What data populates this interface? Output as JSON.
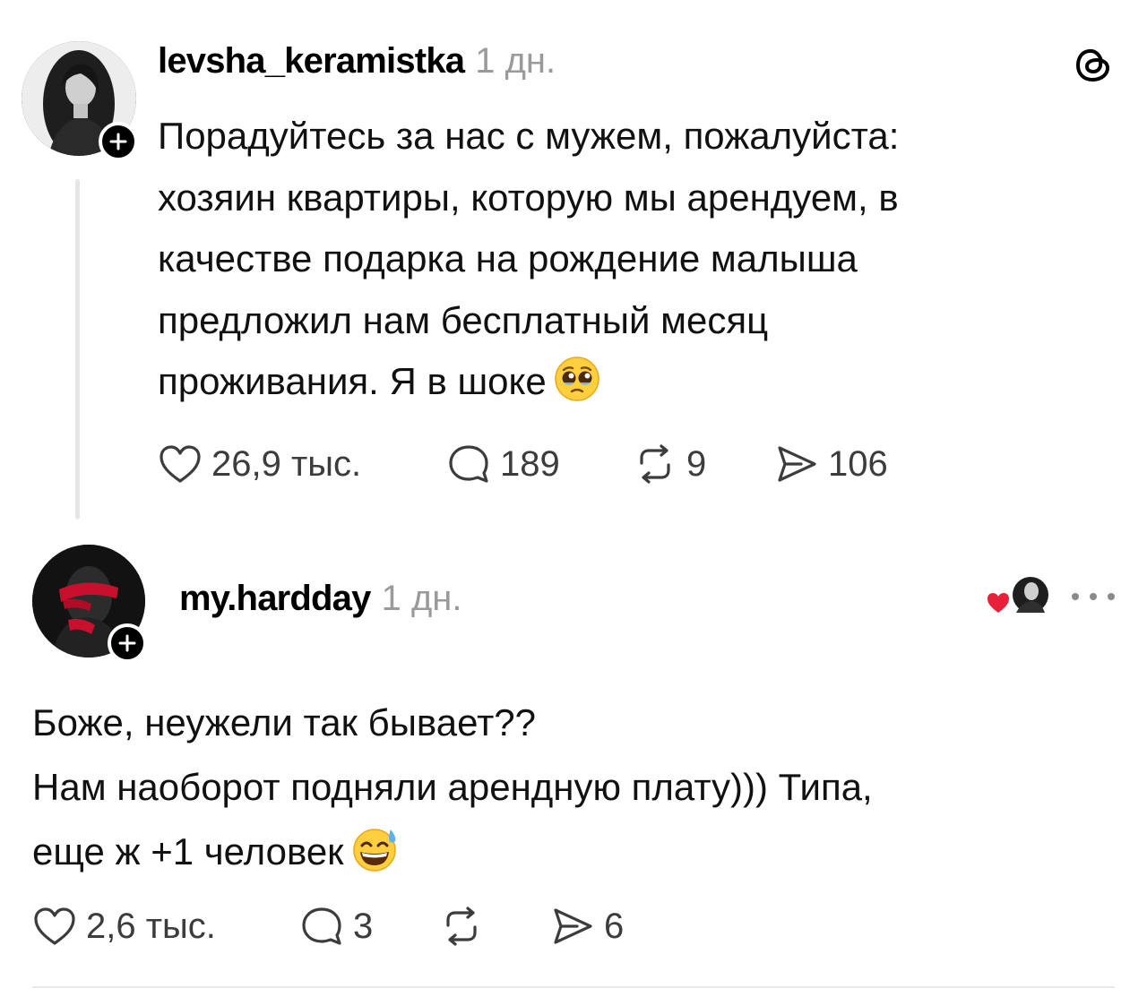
{
  "post": {
    "username": "levsha_keramistka",
    "time": "1 дн.",
    "text_lines": [
      "Порадуйтесь за нас с мужем, пожалуйста:",
      "хозяин квартиры, которую мы арендуем, в",
      "качестве подарка на рождение малыша",
      "предложил нам бесплатный месяц",
      "проживания. Я в шоке"
    ],
    "emoji": "pleading-face",
    "likes": "26,9 тыс.",
    "comments": "189",
    "reposts": "9",
    "shares": "106"
  },
  "reply": {
    "username": "my.hardday",
    "time": "1 дн.",
    "text_lines": [
      "Боже, неужели так бывает??",
      "Нам наоборот подняли арендную плату))) Типа,",
      "еще ж +1 человек"
    ],
    "emoji": "grinning-face-with-sweat",
    "likes": "2,6 тыс.",
    "comments": "3",
    "reposts": "",
    "shares": "6",
    "liked_by_author": true
  },
  "colors": {
    "heart": "#e8203a",
    "muted": "#9a9a9a",
    "reply_accent": "#c8102e"
  },
  "icons": [
    "threads-logo-icon",
    "follow-plus-icon",
    "heart-icon",
    "comment-icon",
    "repost-icon",
    "share-icon",
    "more-icon"
  ]
}
